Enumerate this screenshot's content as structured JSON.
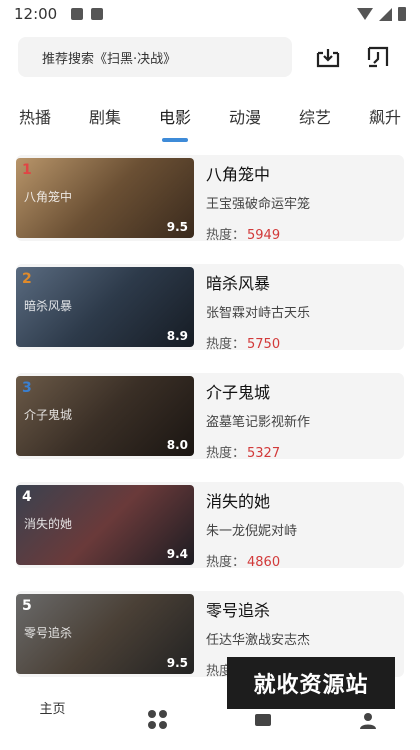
{
  "status_bar": {
    "time": "12:00"
  },
  "search": {
    "text": "推荐搜索《扫黑·决战》"
  },
  "tabs": [
    {
      "label": "热播"
    },
    {
      "label": "剧集"
    },
    {
      "label": "电影"
    },
    {
      "label": "动漫"
    },
    {
      "label": "综艺"
    },
    {
      "label": "飙升"
    }
  ],
  "active_tab_index": 2,
  "heat_label": "热度：",
  "movies": [
    {
      "rank": "1",
      "title": "八角笼中",
      "subtitle": "王宝强破命运牢笼",
      "heat": "5949",
      "score": "9.5",
      "poster_text": "八角笼中",
      "rank_color": "#e04545",
      "poster_colors": [
        "#b8956a",
        "#6b5034",
        "#3a2a1d"
      ]
    },
    {
      "rank": "2",
      "title": "暗杀风暴",
      "subtitle": "张智霖对峙古天乐",
      "heat": "5750",
      "score": "8.9",
      "poster_text": "暗杀风暴",
      "rank_color": "#e08a2a",
      "poster_colors": [
        "#5a6b80",
        "#2d3a4a",
        "#161c24"
      ]
    },
    {
      "rank": "3",
      "title": "介子鬼城",
      "subtitle": "盗墓笔记影视新作",
      "heat": "5327",
      "score": "8.0",
      "poster_text": "介子鬼城",
      "rank_color": "#3a7fd0",
      "poster_colors": [
        "#6b5a48",
        "#3a2f26",
        "#1a1512"
      ]
    },
    {
      "rank": "4",
      "title": "消失的她",
      "subtitle": "朱一龙倪妮对峙",
      "heat": "4860",
      "score": "9.4",
      "poster_text": "消失的她",
      "rank_color": "#ffffff",
      "poster_colors": [
        "#3a4250",
        "#6a3a3a",
        "#1c1c22"
      ]
    },
    {
      "rank": "5",
      "title": "零号追杀",
      "subtitle": "任达华激战安志杰",
      "heat": "",
      "score": "9.5",
      "poster_text": "零号追杀",
      "rank_color": "#ffffff",
      "poster_colors": [
        "#6a6a6a",
        "#4a4036",
        "#222222"
      ]
    }
  ],
  "bottom_nav": [
    {
      "label": "主页",
      "icon": "home-icon"
    },
    {
      "label": "",
      "icon": "grid-icon"
    },
    {
      "label": "",
      "icon": "play-icon"
    },
    {
      "label": "",
      "icon": "user-icon"
    }
  ],
  "watermark": "就收资源站"
}
